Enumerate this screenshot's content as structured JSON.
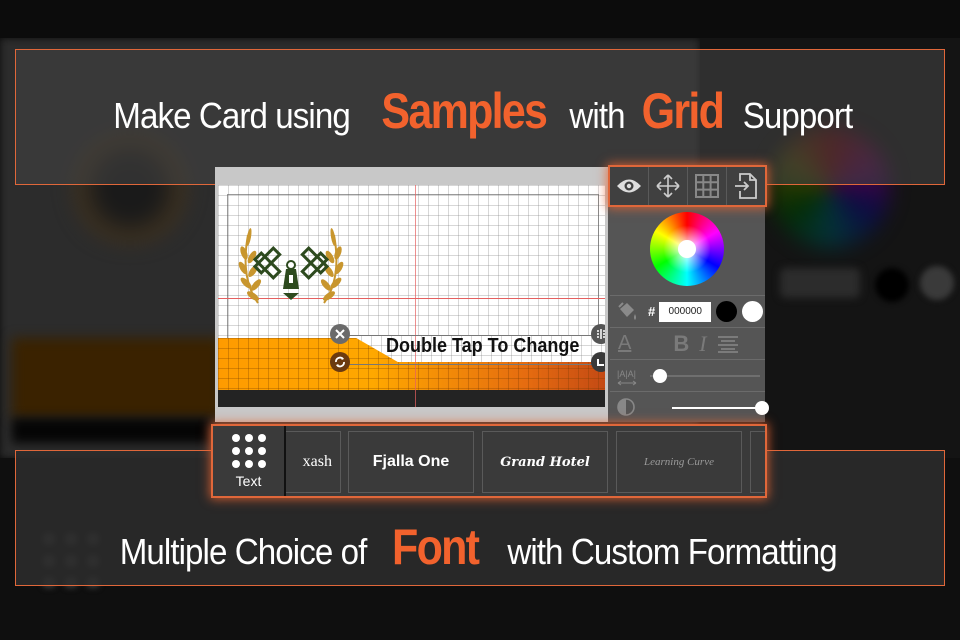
{
  "banners": {
    "top": {
      "parts": [
        {
          "text": "Make Card using",
          "accent": false
        },
        {
          "text": "Samples",
          "accent": true
        },
        {
          "text": "with",
          "accent": false
        },
        {
          "text": "Grid",
          "accent": true
        },
        {
          "text": "Support",
          "accent": false
        }
      ]
    },
    "bottom": {
      "parts": [
        {
          "text": "Multiple Choice of",
          "accent": false
        },
        {
          "text": "Font",
          "accent": true
        },
        {
          "text": "with Custom Formatting",
          "accent": false
        }
      ]
    }
  },
  "colors": {
    "accent": "#f2622d",
    "border": "#e0673a",
    "panel": "#555555",
    "toolbar": "#404040",
    "card_orange": "#ffa800",
    "card_dark": "#232323",
    "logo_green": "#2d4a1e",
    "logo_gold": "#c8962e"
  },
  "toolbar": {
    "icons": [
      "eye-icon",
      "move-icon",
      "grid-icon",
      "import-icon"
    ]
  },
  "canvas": {
    "text": "Double Tap To Change"
  },
  "color_row": {
    "hash": "#",
    "hex_value": "000000",
    "swatches": [
      "#000000",
      "#ffffff"
    ]
  },
  "format_row": {
    "bold": "B",
    "italic": "I",
    "underline_a": "A"
  },
  "sliders": {
    "letter_spacing": 0.0,
    "opacity": 1.0
  },
  "font_strip": {
    "tab_label": "Text",
    "fonts": [
      "Alex Brush",
      "Fjalla One",
      "Grand Hotel",
      "Learning Curve"
    ],
    "first_visible_fragment": "xash"
  }
}
